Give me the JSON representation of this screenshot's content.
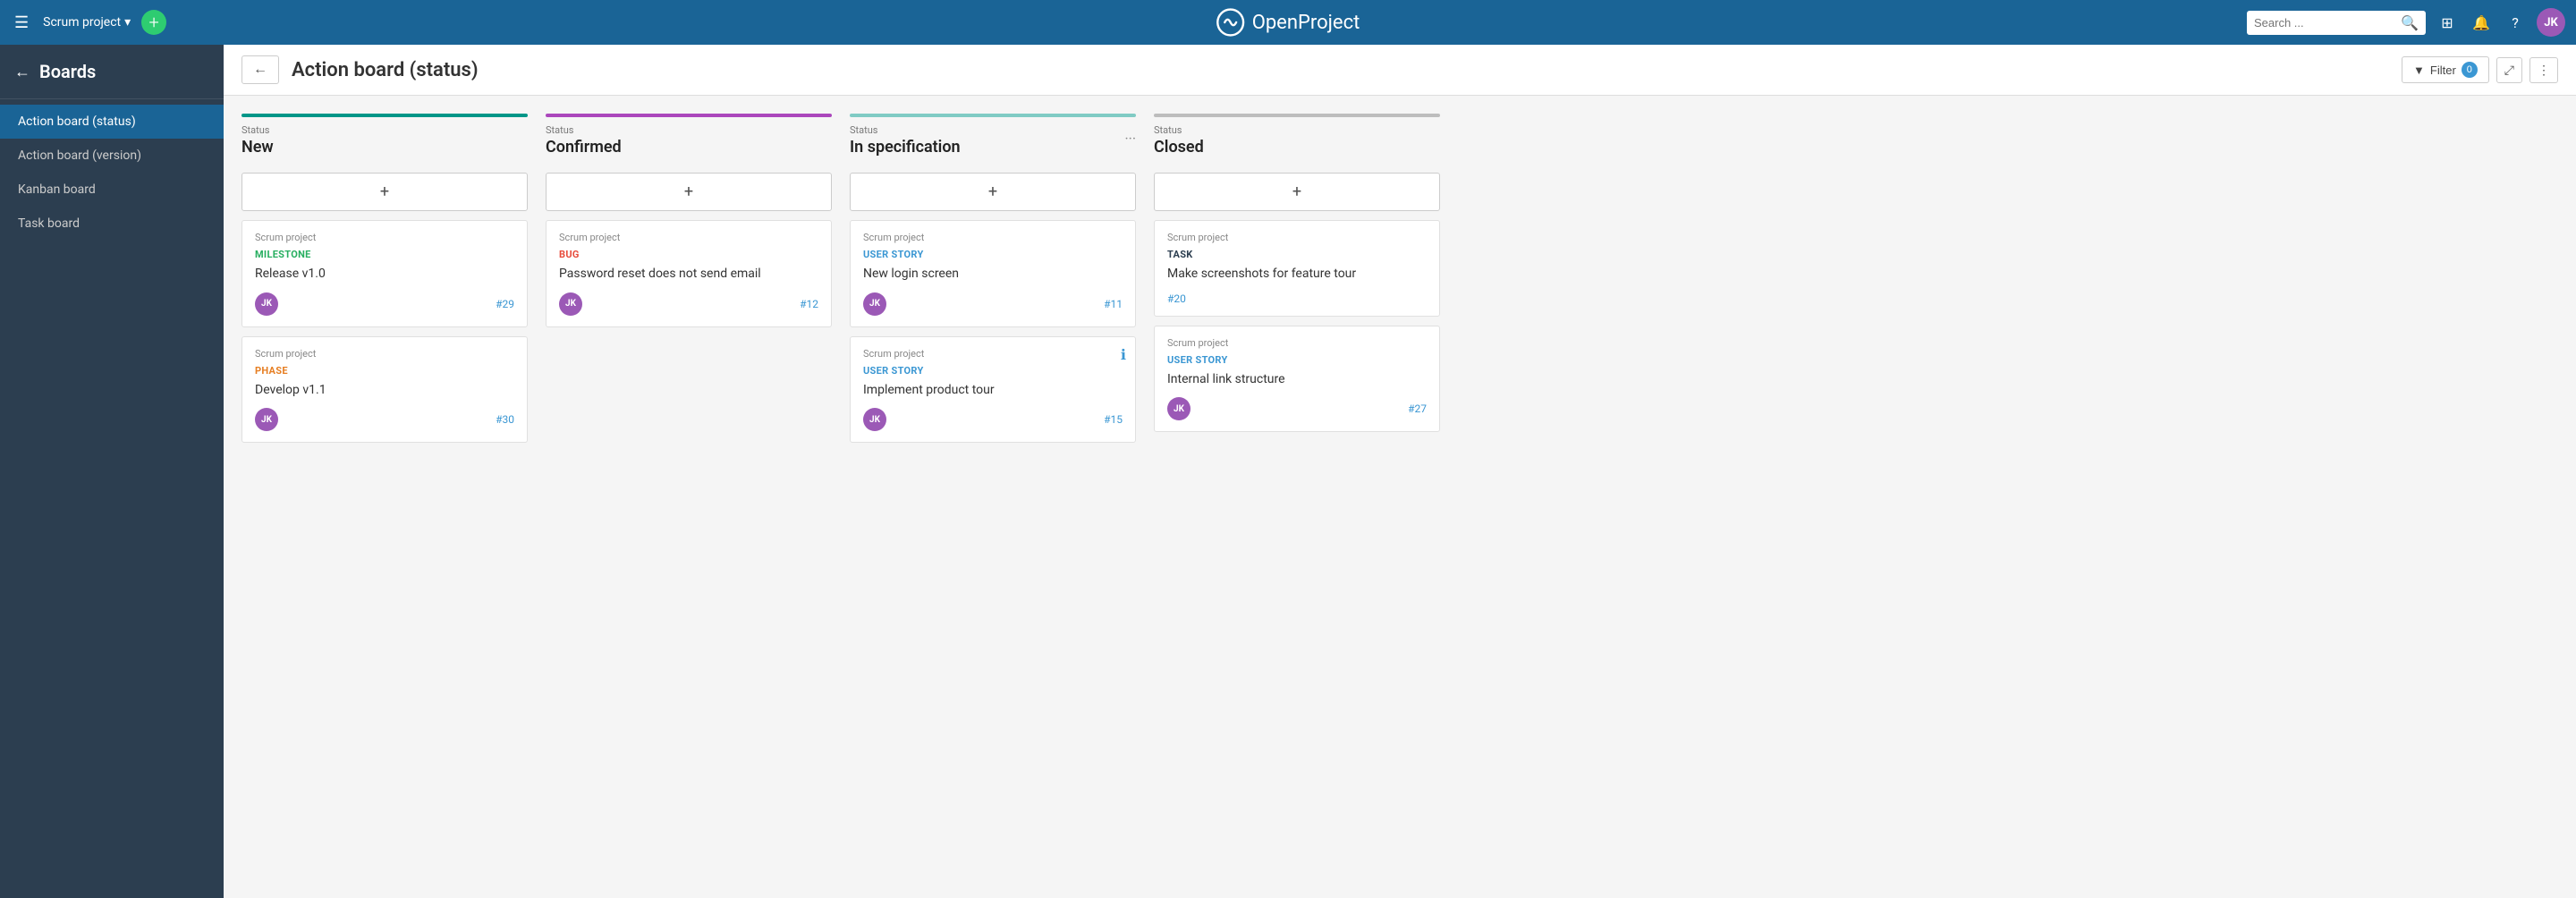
{
  "topnav": {
    "project_name": "Scrum project",
    "logo_text": "OpenProject",
    "search_placeholder": "Search ...",
    "avatar_initials": "JK"
  },
  "sidebar": {
    "title": "Boards",
    "items": [
      {
        "id": "action-status",
        "label": "Action board (status)",
        "active": true
      },
      {
        "id": "action-version",
        "label": "Action board (version)",
        "active": false
      },
      {
        "id": "kanban",
        "label": "Kanban board",
        "active": false
      },
      {
        "id": "task",
        "label": "Task board",
        "active": false
      }
    ]
  },
  "main": {
    "title": "Action board (status)",
    "filter_label": "Filter",
    "filter_count": "0"
  },
  "columns": [
    {
      "id": "new",
      "color": "#009688",
      "status_label": "Status",
      "name": "New",
      "cards": [
        {
          "project": "Scrum project",
          "type": "MILESTONE",
          "type_class": "milestone",
          "title": "Release v1.0",
          "id": "#29",
          "has_avatar": true
        },
        {
          "project": "Scrum project",
          "type": "PHASE",
          "type_class": "phase",
          "title": "Develop v1.1",
          "id": "#30",
          "has_avatar": true
        }
      ]
    },
    {
      "id": "confirmed",
      "color": "#ab47bc",
      "status_label": "Status",
      "name": "Confirmed",
      "cards": [
        {
          "project": "Scrum project",
          "type": "BUG",
          "type_class": "bug",
          "title": "Password reset does not send email",
          "id": "#12",
          "has_avatar": true
        }
      ]
    },
    {
      "id": "in-specification",
      "color": "#80cbc4",
      "status_label": "Status",
      "name": "In specification",
      "has_dots": true,
      "cards": [
        {
          "project": "Scrum project",
          "type": "USER STORY",
          "type_class": "user-story",
          "title": "New login screen",
          "id": "#11",
          "has_avatar": true
        },
        {
          "project": "Scrum project",
          "type": "USER STORY",
          "type_class": "user-story",
          "title": "Implement product tour",
          "id": "#15",
          "has_avatar": true,
          "has_info": true
        }
      ]
    },
    {
      "id": "closed",
      "color": "#bdbdbd",
      "status_label": "Status",
      "name": "Closed",
      "cards": [
        {
          "project": "Scrum project",
          "type": "TASK",
          "type_class": "task",
          "title": "Make screenshots for feature tour",
          "id": "#20",
          "has_avatar": false
        },
        {
          "project": "Scrum project",
          "type": "USER STORY",
          "type_class": "user-story",
          "title": "Internal link structure",
          "id": "#27",
          "has_avatar": true
        }
      ]
    }
  ]
}
